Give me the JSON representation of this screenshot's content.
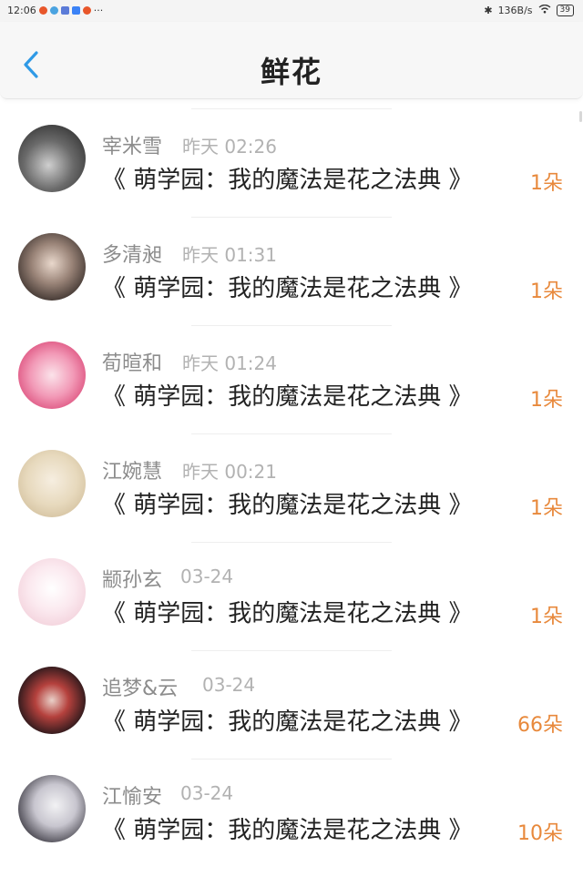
{
  "status_bar": {
    "time": "12:06",
    "more": "···",
    "network_speed": "136B/s",
    "battery": "39"
  },
  "header": {
    "title": "鲜花",
    "back_icon": "chevron-left-icon"
  },
  "colors": {
    "accent": "#e8893c",
    "back": "#2f9ae6",
    "name": "#8c8c8c",
    "time": "#b2b2b2"
  },
  "items": [
    {
      "name": "宰米雪",
      "time": "昨天 02:26",
      "book": "《 萌学园：我的魔法是花之法典 》",
      "count": "1朵"
    },
    {
      "name": "多清昶",
      "time": "昨天 01:31",
      "book": "《 萌学园：我的魔法是花之法典 》",
      "count": "1朵"
    },
    {
      "name": "荀暄和",
      "time": "昨天 01:24",
      "book": "《 萌学园：我的魔法是花之法典 》",
      "count": "1朵"
    },
    {
      "name": "江婉慧",
      "time": "昨天 00:21",
      "book": "《 萌学园：我的魔法是花之法典 》",
      "count": "1朵"
    },
    {
      "name": "颛孙玄",
      "time": "03-24",
      "book": "《 萌学园：我的魔法是花之法典 》",
      "count": "1朵"
    },
    {
      "name": "追梦&云",
      "time": "03-24",
      "book": "《 萌学园：我的魔法是花之法典 》",
      "count": "66朵"
    },
    {
      "name": "江愉安",
      "time": "03-24",
      "book": "《 萌学园：我的魔法是花之法典 》",
      "count": "10朵"
    }
  ]
}
